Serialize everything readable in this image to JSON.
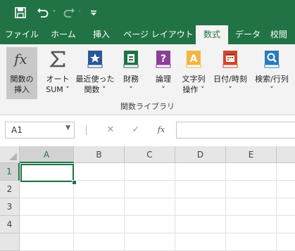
{
  "quick_access": {
    "save_icon": "save-icon",
    "undo_icon": "undo-icon",
    "redo_icon": "redo-icon",
    "customize_icon": "customize-icon"
  },
  "tabs": [
    {
      "label": "ファイル"
    },
    {
      "label": "ホーム"
    },
    {
      "label": "挿入"
    },
    {
      "label": "ページ レイアウト"
    },
    {
      "label": "数式",
      "active": true
    },
    {
      "label": "データ"
    },
    {
      "label": "校閲"
    }
  ],
  "ribbon": {
    "buttons": [
      {
        "line1": "関数の",
        "line2": "挿入",
        "icon": "fx-icon"
      },
      {
        "line1": "オート",
        "line2": "SUM ˅",
        "icon": "sigma-icon"
      },
      {
        "line1": "最近使った",
        "line2": "関数 ˅",
        "icon": "star-book-icon"
      },
      {
        "line1": "財務",
        "line2": "˅",
        "icon": "finance-book-icon"
      },
      {
        "line1": "論理",
        "line2": "˅",
        "icon": "logic-book-icon"
      },
      {
        "line1": "文字列",
        "line2": "操作 ˅",
        "icon": "text-book-icon"
      },
      {
        "line1": "日付/時刻",
        "line2": "˅",
        "icon": "calendar-book-icon"
      },
      {
        "line1": "検索/行列",
        "line2": "˅",
        "icon": "lookup-book-icon"
      }
    ],
    "group_label": "関数ライブラリ"
  },
  "formula_bar": {
    "name_box": "A1",
    "cancel": "✕",
    "enter": "✓",
    "fx": "fx",
    "value": ""
  },
  "sheet": {
    "columns": [
      "A",
      "B",
      "C",
      "D",
      "E"
    ],
    "rows": [
      "1",
      "2",
      "3",
      "4"
    ],
    "active_cell": "A1"
  },
  "colors": {
    "accent": "#217346",
    "ribbon_bg": "#f3f3f3"
  }
}
